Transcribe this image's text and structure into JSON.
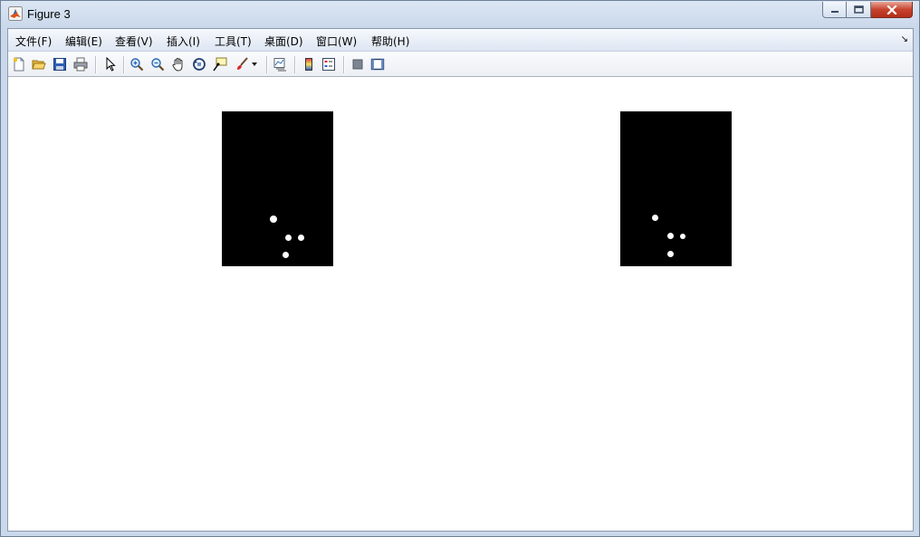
{
  "window": {
    "title": "Figure 3",
    "icon": "matlab-icon"
  },
  "menubar": {
    "items": [
      {
        "label": "文件(F)"
      },
      {
        "label": "编辑(E)"
      },
      {
        "label": "查看(V)"
      },
      {
        "label": "插入(I)"
      },
      {
        "label": "工具(T)"
      },
      {
        "label": "桌面(D)"
      },
      {
        "label": "窗口(W)"
      },
      {
        "label": "帮助(H)"
      }
    ],
    "overflow_icon": "dock-arrow-icon"
  },
  "toolbar": {
    "buttons": [
      "new-figure-icon",
      "open-file-icon",
      "save-icon",
      "print-icon",
      "edit-plot-icon",
      "zoom-in-icon",
      "zoom-out-icon",
      "pan-icon",
      "rotate-3d-icon",
      "data-cursor-icon",
      "brush-icon",
      "link-plot-icon",
      "colorbar-icon",
      "legend-icon",
      "hide-plot-tools-icon",
      "show-plot-tools-icon"
    ]
  },
  "figure": {
    "background": "#ffffff",
    "images": [
      {
        "name": "binary-image-left"
      },
      {
        "name": "binary-image-right"
      }
    ]
  }
}
